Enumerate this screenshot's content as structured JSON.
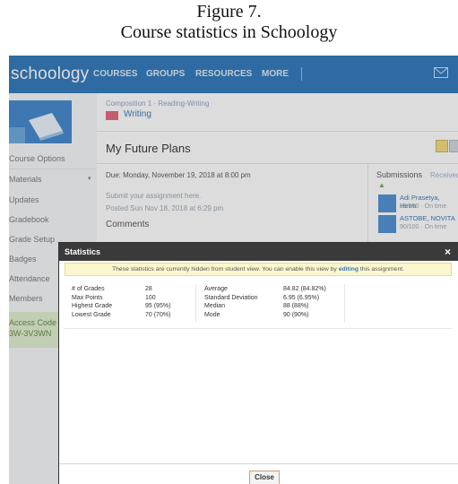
{
  "figure": {
    "label": "Figure 7.",
    "caption": "Course statistics in Schoology"
  },
  "topbar": {
    "logo": "schoology",
    "nav": [
      "COURSES",
      "GROUPS",
      "RESOURCES",
      "MORE"
    ],
    "color": "#2b76b9"
  },
  "sidebar": {
    "items": [
      "Course Options",
      "Materials",
      "Updates",
      "Gradebook",
      "Grade Setup",
      "Badges",
      "Attendance",
      "Members"
    ],
    "access_code_label": "Access Code",
    "access_code_value": "3W-3V3WN"
  },
  "page": {
    "breadcrumb": "Composition 1 · Reading-Writing",
    "folder": "Writing",
    "title": "My Future Plans",
    "due": "Due: Monday, November 19, 2018 at 8:00 pm",
    "submit_text": "Submit your assignment here.",
    "posted": "Posted Sun Nov 18, 2018 at 6:29 pm",
    "comments": "Comments"
  },
  "submissions": {
    "title": "Submissions",
    "tab": "Received",
    "items": [
      {
        "name": "Adi Prasetya, Herm",
        "status": "95/100 · On time"
      },
      {
        "name": "ASTOBE, NOVITA",
        "status": "90/100 · On time"
      }
    ]
  },
  "modal": {
    "title": "Statistics",
    "notice_before": "These statistics are currently hidden from student view. You can enable this view by ",
    "notice_link": "editing",
    "notice_after": " this assignment.",
    "left_stats": [
      {
        "label": "# of Grades",
        "value": "28"
      },
      {
        "label": "Max Points",
        "value": "100"
      },
      {
        "label": "Highest Grade",
        "value": "95 (95%)"
      },
      {
        "label": "Lowest Grade",
        "value": "70 (70%)"
      }
    ],
    "right_stats": [
      {
        "label": "Average",
        "value": "84.82 (84.82%)"
      },
      {
        "label": "Standard Deviation",
        "value": "6.95 (6.95%)"
      },
      {
        "label": "Median",
        "value": "88 (88%)"
      },
      {
        "label": "Mode",
        "value": "90 (90%)"
      }
    ],
    "close_label": "Close",
    "close_x": "×"
  }
}
